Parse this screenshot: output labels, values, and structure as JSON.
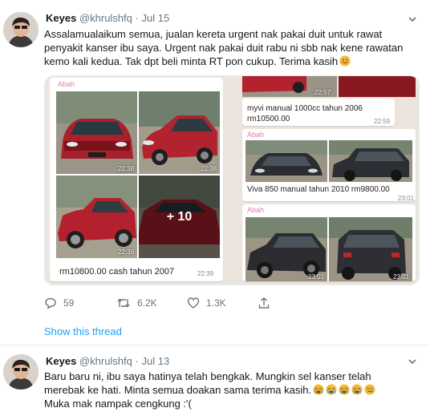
{
  "tweet1": {
    "name": "Keyes",
    "handle": "@khrulshfq",
    "separator": "·",
    "date": "Jul 15",
    "text": "Assalamualaikum semua, jualan kereta urgent nak pakai duit untuk rawat\npenyakit kanser ibu saya. Urgent nak pakai duit rabu ni sbb nak kene rawatan\nkemo kali kedua. Tak dpt beli minta RT pon cukup. Terima kasih",
    "emoji_icon": "smiling-face-icon",
    "media": {
      "left_panel": {
        "sender": "Abah",
        "photo_times": [
          "22:38",
          "22:38",
          "22:39"
        ],
        "more_count": "+ 10",
        "caption": "rm10800.00 cash tahun 2007",
        "caption_time": "22:39"
      },
      "right_panel": {
        "top_time": "22:57",
        "listing1_caption": "myvi manual 1000cc tahun 2006\nrm10500.00",
        "listing1_time": "22:59",
        "sender": "Abah",
        "listing2_caption": "Viva 850 manual tahun 2010 rm9800.00",
        "listing2_time": "23:01",
        "sender2": "Abah",
        "bottom_times": [
          "23:01",
          "23:01"
        ]
      }
    },
    "actions": {
      "reply_count": "59",
      "retweet_count": "6.2K",
      "like_count": "1.3K"
    },
    "show_thread": "Show this thread"
  },
  "tweet2": {
    "name": "Keyes",
    "handle": "@khrulshfq",
    "separator": "·",
    "date": "Jul 13",
    "text": "Baru baru ni, ibu saya hatinya telah bengkak. Mungkin sel kanser telah\nmerebak ke hati. Minta semua doakan sama terima kasih.",
    "text2": "Muka mak nampak cengkung :'(",
    "emoji_icons": [
      "crying-face-icon",
      "crying-face-icon",
      "crying-face-icon",
      "crying-face-icon",
      "sad-face-icon"
    ]
  },
  "colors": {
    "accent": "#1da1f2",
    "muted": "#657786",
    "car_red": "#a8202b",
    "car_black": "#2b2d31",
    "whatsapp_bg": "#ece5dd"
  }
}
